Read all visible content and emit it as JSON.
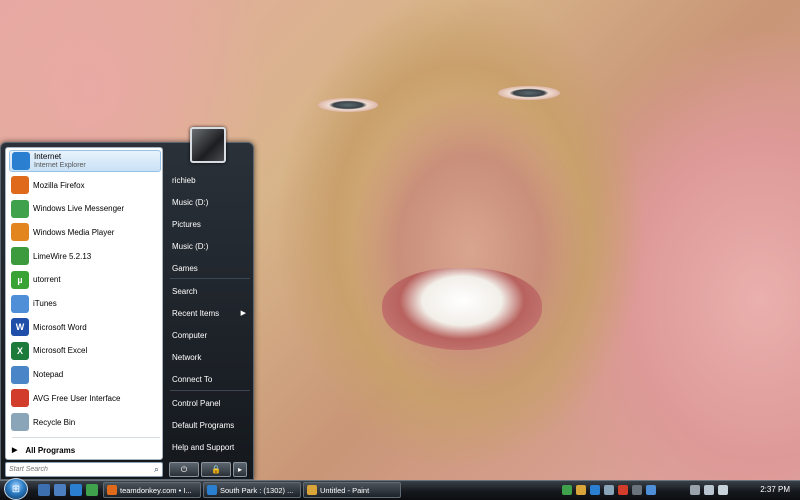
{
  "start_menu": {
    "pinned": [
      {
        "name": "Internet",
        "sub": "Internet Explorer",
        "icon": "internet-explorer-icon",
        "color": "#2a7fd0"
      }
    ],
    "programs": [
      {
        "name": "Mozilla Firefox",
        "icon": "firefox-icon",
        "color": "#e06a1b"
      },
      {
        "name": "Windows Live Messenger",
        "icon": "messenger-icon",
        "color": "#3fa14b"
      },
      {
        "name": "Windows Media Player",
        "icon": "media-player-icon",
        "color": "#e3851f"
      },
      {
        "name": "LimeWire 5.2.13",
        "icon": "limewire-icon",
        "color": "#3d9a3d"
      },
      {
        "name": "utorrent",
        "icon": "utorrent-icon",
        "color": "#3aa336",
        "glyph": "µ"
      },
      {
        "name": "iTunes",
        "icon": "itunes-icon",
        "color": "#4f8fd8"
      },
      {
        "name": "Microsoft Word",
        "icon": "word-icon",
        "color": "#1f4fa8",
        "glyph": "W"
      },
      {
        "name": "Microsoft Excel",
        "icon": "excel-icon",
        "color": "#1c7a3a",
        "glyph": "X"
      },
      {
        "name": "Notepad",
        "icon": "notepad-icon",
        "color": "#4a86c7"
      },
      {
        "name": "AVG Free User Interface",
        "icon": "avg-icon",
        "color": "#d23c2a"
      },
      {
        "name": "Recycle Bin",
        "icon": "recycle-bin-icon",
        "color": "#8aa4b8"
      }
    ],
    "all_programs": "All Programs",
    "search_placeholder": "Start Search",
    "places": [
      {
        "label": "richieb"
      },
      {
        "label": "Music (D:)"
      },
      {
        "label": "Pictures"
      },
      {
        "label": "Music (D:)"
      },
      {
        "label": "Games"
      },
      {
        "label": "Search"
      },
      {
        "label": "Recent Items",
        "submenu": true
      },
      {
        "label": "Computer"
      },
      {
        "label": "Network"
      },
      {
        "label": "Connect To"
      },
      {
        "label": "Control Panel"
      },
      {
        "label": "Default Programs"
      },
      {
        "label": "Help and Support"
      }
    ],
    "power_glyph": "⏻",
    "lock_glyph": "🔒",
    "more_glyph": "▸"
  },
  "taskbar": {
    "start_glyph": "⊞",
    "tasks": [
      {
        "label": "teamdonkey.com • I...",
        "color": "#e06a1b"
      },
      {
        "label": "South Park : (1302) ...",
        "color": "#2a7fd0"
      },
      {
        "label": "Untitled - Paint",
        "color": "#d9a43a"
      }
    ],
    "clock": "2:37 PM"
  }
}
